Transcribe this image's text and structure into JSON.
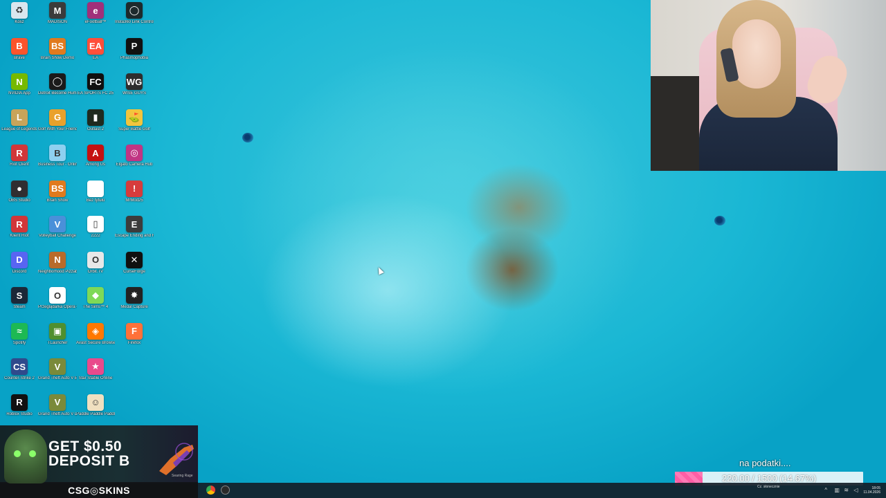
{
  "desktop": {
    "icons": [
      {
        "label": "Kosz",
        "color": "#d9e6ee",
        "glyph": "♻",
        "col": 0,
        "row": 0
      },
      {
        "label": "MADISON",
        "color": "#3b3b3b",
        "glyph": "M",
        "col": 1,
        "row": 0
      },
      {
        "label": "eFootball™",
        "color": "#a0307a",
        "glyph": "e",
        "col": 2,
        "row": 0
      },
      {
        "label": "Insta360 Link Controller",
        "color": "#1d2a2c",
        "glyph": "◯",
        "col": 3,
        "row": 0
      },
      {
        "label": "Brave",
        "color": "#fb542b",
        "glyph": "B",
        "col": 0,
        "row": 1
      },
      {
        "label": "Brain Show Demo",
        "color": "#e07a1e",
        "glyph": "BS",
        "col": 1,
        "row": 1
      },
      {
        "label": "EA",
        "color": "#ff4f3a",
        "glyph": "EA",
        "col": 2,
        "row": 1
      },
      {
        "label": "Phasmophobia",
        "color": "#111111",
        "glyph": "P",
        "col": 3,
        "row": 1
      },
      {
        "label": "NVIDIA App",
        "color": "#76b900",
        "glyph": "N",
        "col": 0,
        "row": 2
      },
      {
        "label": "Detroit Become Human",
        "color": "#1a1a1a",
        "glyph": "◯",
        "col": 1,
        "row": 2
      },
      {
        "label": "EA SPORTS FC 25",
        "color": "#101010",
        "glyph": "FC",
        "col": 2,
        "row": 2
      },
      {
        "label": "WISE GUYS",
        "color": "#2e2e2e",
        "glyph": "WG",
        "col": 3,
        "row": 2
      },
      {
        "label": "League of Legends",
        "color": "#c8a45a",
        "glyph": "L",
        "col": 0,
        "row": 3
      },
      {
        "label": "Golf With Your Friends",
        "color": "#e9a12b",
        "glyph": "G",
        "col": 1,
        "row": 3
      },
      {
        "label": "Outlast 2",
        "color": "#1f2a1f",
        "glyph": "▮",
        "col": 2,
        "row": 3
      },
      {
        "label": "Super Battle Golf",
        "color": "#f2c53d",
        "glyph": "⛳",
        "col": 3,
        "row": 3
      },
      {
        "label": "Riot Client",
        "color": "#d13639",
        "glyph": "R",
        "col": 0,
        "row": 4
      },
      {
        "label": "Business Tour - Online Multipla...",
        "color": "#8ed0f0",
        "glyph": "B",
        "col": 1,
        "row": 4
      },
      {
        "label": "Among Us",
        "color": "#c51111",
        "glyph": "A",
        "col": 2,
        "row": 4
      },
      {
        "label": "Elgato Camera Hub",
        "color": "#c13584",
        "glyph": "◎",
        "col": 3,
        "row": 4
      },
      {
        "label": "OBS Studio",
        "color": "#302e31",
        "glyph": "●",
        "col": 0,
        "row": 5
      },
      {
        "label": "Brain Show",
        "color": "#e07a1e",
        "glyph": "BS",
        "col": 1,
        "row": 5
      },
      {
        "label": "Bez tytułu",
        "color": "#ffffff",
        "glyph": "",
        "col": 2,
        "row": 5
      },
      {
        "label": "MrMod25",
        "color": "#d63c3c",
        "glyph": "!",
        "col": 3,
        "row": 5
      },
      {
        "label": "Klient Riot",
        "color": "#d13639",
        "glyph": "R",
        "col": 0,
        "row": 6
      },
      {
        "label": "Volleyball Challenge",
        "color": "#4a90d9",
        "glyph": "V",
        "col": 1,
        "row": 6
      },
      {
        "label": "2222",
        "color": "#ffffff",
        "glyph": "▯",
        "col": 2,
        "row": 6
      },
      {
        "label": "Escape Ending and Recovery Episode",
        "color": "#3c3c3c",
        "glyph": "E",
        "col": 3,
        "row": 6
      },
      {
        "label": "Discord",
        "color": "#5865f2",
        "glyph": "D",
        "col": 0,
        "row": 7
      },
      {
        "label": "Neighborhood Pizzabot From Hell",
        "color": "#b86b2a",
        "glyph": "N",
        "col": 1,
        "row": 7
      },
      {
        "label": "Orbit.TV",
        "color": "#e8e8e8",
        "glyph": "O",
        "col": 2,
        "row": 7
      },
      {
        "label": "CurseForge",
        "color": "#101010",
        "glyph": "✕",
        "col": 3,
        "row": 7
      },
      {
        "label": "Steam",
        "color": "#1b2838",
        "glyph": "S",
        "col": 0,
        "row": 8
      },
      {
        "label": "Przeglądarka Opera GX",
        "color": "#ffffff",
        "glyph": "O",
        "col": 1,
        "row": 8
      },
      {
        "label": "The Sims™ 4",
        "color": "#7ed957",
        "glyph": "◆",
        "col": 2,
        "row": 8
      },
      {
        "label": "Medal Capture",
        "color": "#222222",
        "glyph": "✸",
        "col": 3,
        "row": 8
      },
      {
        "label": "Spotify",
        "color": "#1db954",
        "glyph": "≈",
        "col": 0,
        "row": 9
      },
      {
        "label": "TLauncher",
        "color": "#4f8f2f",
        "glyph": "▣",
        "col": 1,
        "row": 9
      },
      {
        "label": "Avast Secure Browser",
        "color": "#ff7800",
        "glyph": "◈",
        "col": 2,
        "row": 9
      },
      {
        "label": "Firefox",
        "color": "#ff7139",
        "glyph": "F",
        "col": 3,
        "row": 9
      },
      {
        "label": "Counter-Strike 2",
        "color": "#2f4a8c",
        "glyph": "CS",
        "col": 0,
        "row": 10
      },
      {
        "label": "Grand Theft Auto V Enhanced",
        "color": "#7a8a3a",
        "glyph": "V",
        "col": 1,
        "row": 10
      },
      {
        "label": "Star Stable Online",
        "color": "#e94a8c",
        "glyph": "★",
        "col": 2,
        "row": 10
      },
      {
        "label": "Roblox Studio",
        "color": "#111111",
        "glyph": "R",
        "col": 0,
        "row": 11
      },
      {
        "label": "Grand Theft Auto V Legacy",
        "color": "#7a8a3a",
        "glyph": "V",
        "col": 1,
        "row": 11
      },
      {
        "label": "Paddle Paddle Paddle",
        "color": "#f0e0c0",
        "glyph": "☺",
        "col": 2,
        "row": 11
      }
    ]
  },
  "ad": {
    "headline_line1": "GET $0.50",
    "headline_line2": "DEPOSIT B",
    "item_label": "Searing Rage",
    "brand": "CSG◎SKINS"
  },
  "goal": {
    "caption": "na podatki....",
    "current": 220.0,
    "target": 1500,
    "progress": 0.1467,
    "text": "220.00 / 1500 (14.67%)"
  },
  "taskbar": {
    "weather": "Cz. słonecznie",
    "time": "18:05",
    "date": "11.04.2026",
    "pinned": [
      "chrome-icon",
      "obs-icon"
    ]
  },
  "colors": {
    "wallpaper": "#1ab7d4",
    "goal_fill": "#ff6fb0",
    "taskbar": "#141e28"
  }
}
